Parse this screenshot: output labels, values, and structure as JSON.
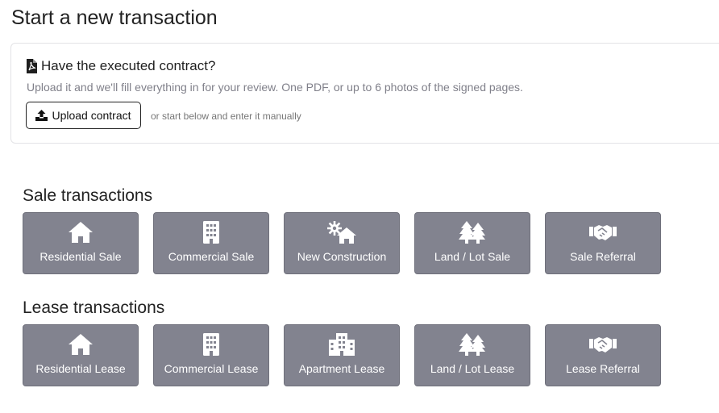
{
  "page": {
    "title": "Start a new transaction"
  },
  "upload": {
    "title": "Have the executed contract?",
    "subtitle": "Upload it and we'll fill everything in for your review. One PDF, or up to 6 photos of the signed pages.",
    "button_label": "Upload contract",
    "manual_hint": "or start below and enter it manually",
    "title_icon": "pdf-file-icon",
    "button_icon": "upload-icon"
  },
  "sale": {
    "title": "Sale transactions",
    "tiles": [
      {
        "label": "Residential Sale",
        "icon": "house-icon"
      },
      {
        "label": "Commercial Sale",
        "icon": "building-icon"
      },
      {
        "label": "New Construction",
        "icon": "gear-house-icon"
      },
      {
        "label": "Land / Lot Sale",
        "icon": "trees-icon"
      },
      {
        "label": "Sale Referral",
        "icon": "handshake-icon"
      }
    ]
  },
  "lease": {
    "title": "Lease transactions",
    "tiles": [
      {
        "label": "Residential Lease",
        "icon": "house-icon"
      },
      {
        "label": "Commercial Lease",
        "icon": "building-icon"
      },
      {
        "label": "Apartment Lease",
        "icon": "apartment-building-icon"
      },
      {
        "label": "Land / Lot Lease",
        "icon": "trees-icon"
      },
      {
        "label": "Lease Referral",
        "icon": "handshake-icon"
      }
    ]
  },
  "colors": {
    "tile_bg": "#82838f",
    "tile_text": "#ffffff",
    "subtitle": "#80808a"
  }
}
